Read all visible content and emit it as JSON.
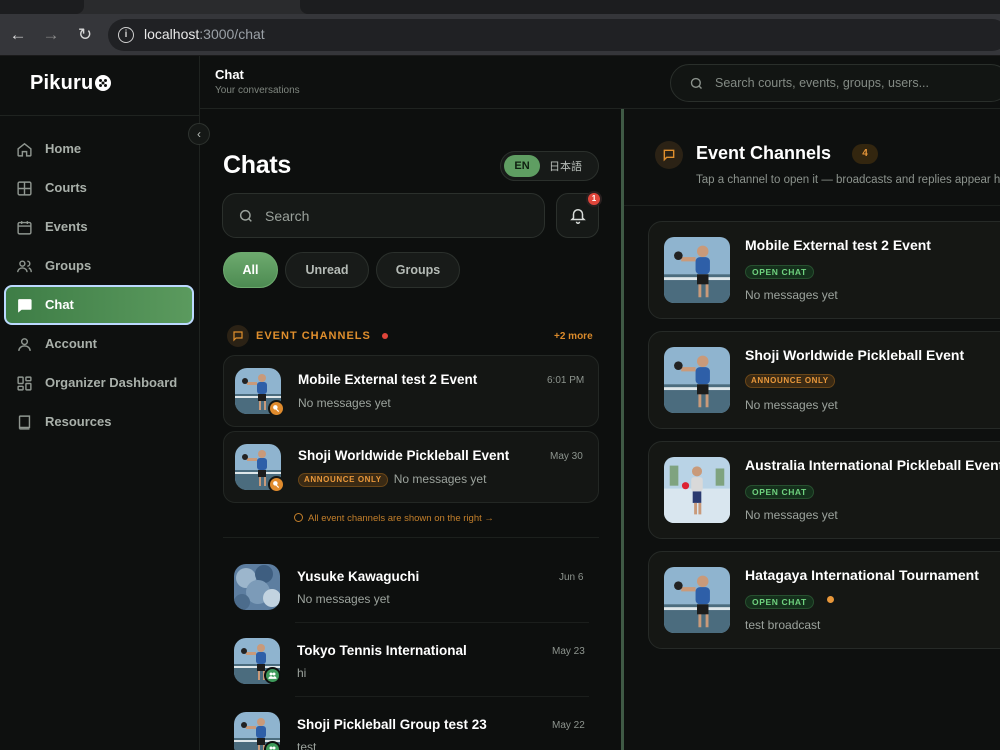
{
  "browser": {
    "url_host": "localhost",
    "url_path": ":3000/chat"
  },
  "brand": {
    "name": "Pikuru"
  },
  "sidebar": {
    "items": [
      {
        "label": "Home",
        "icon": "home-icon",
        "active": false
      },
      {
        "label": "Courts",
        "icon": "grid-icon",
        "active": false
      },
      {
        "label": "Events",
        "icon": "calendar-icon",
        "active": false
      },
      {
        "label": "Groups",
        "icon": "users-icon",
        "active": false
      },
      {
        "label": "Chat",
        "icon": "chat-icon",
        "active": true
      },
      {
        "label": "Account",
        "icon": "person-icon",
        "active": false
      },
      {
        "label": "Organizer Dashboard",
        "icon": "dashboard-icon",
        "active": false
      },
      {
        "label": "Resources",
        "icon": "book-icon",
        "active": false
      }
    ]
  },
  "header": {
    "title": "Chat",
    "subtitle": "Your conversations",
    "search_placeholder": "Search courts, events, groups, users..."
  },
  "chats": {
    "title": "Chats",
    "lang_en": "EN",
    "lang_ja": "日本語",
    "search_placeholder": "Search",
    "notification_count": "1",
    "filters": [
      "All",
      "Unread",
      "Groups"
    ],
    "active_filter": "All",
    "event_channels_label": "EVENT CHANNELS",
    "more_label": "+2 more",
    "event_items": [
      {
        "title": "Mobile External test 2 Event",
        "time": "6:01 PM",
        "tag": "",
        "preview": "No messages yet"
      },
      {
        "title": "Shoji Worldwide Pickleball Event",
        "time": "May 30",
        "tag": "ANNOUNCE ONLY",
        "preview": "No messages yet"
      }
    ],
    "right_note": "All event channels are shown on the right →",
    "conversations": [
      {
        "title": "Yusuke Kawaguchi",
        "time": "Jun 6",
        "preview": "No messages yet",
        "badge": ""
      },
      {
        "title": "Tokyo Tennis International",
        "time": "May 23",
        "preview": "hi",
        "badge": "group"
      },
      {
        "title": "Shoji Pickleball Group test 23",
        "time": "May 22",
        "preview": "test",
        "badge": "group"
      }
    ]
  },
  "event_channels": {
    "title": "Event Channels",
    "count": "4",
    "subtitle": "Tap a channel to open it — broadcasts and replies appear here",
    "channels": [
      {
        "title": "Mobile External test 2 Event",
        "tag": "OPEN CHAT",
        "tag_type": "open",
        "preview": "No messages yet",
        "unread_dot": false
      },
      {
        "title": "Shoji Worldwide Pickleball Event",
        "tag": "ANNOUNCE ONLY",
        "tag_type": "announce",
        "preview": "No messages yet",
        "unread_dot": false
      },
      {
        "title": "Australia International Pickleball Event",
        "tag": "OPEN CHAT",
        "tag_type": "open",
        "preview": "No messages yet",
        "unread_dot": false
      },
      {
        "title": "Hatagaya International Tournament",
        "tag": "OPEN CHAT",
        "tag_type": "open",
        "preview": "test broadcast",
        "unread_dot": true
      }
    ]
  },
  "colors": {
    "accent_green": "#5f9e62",
    "accent_orange": "#e08f2d",
    "badge_red": "#e0453a",
    "background": "#0c0d0c"
  }
}
